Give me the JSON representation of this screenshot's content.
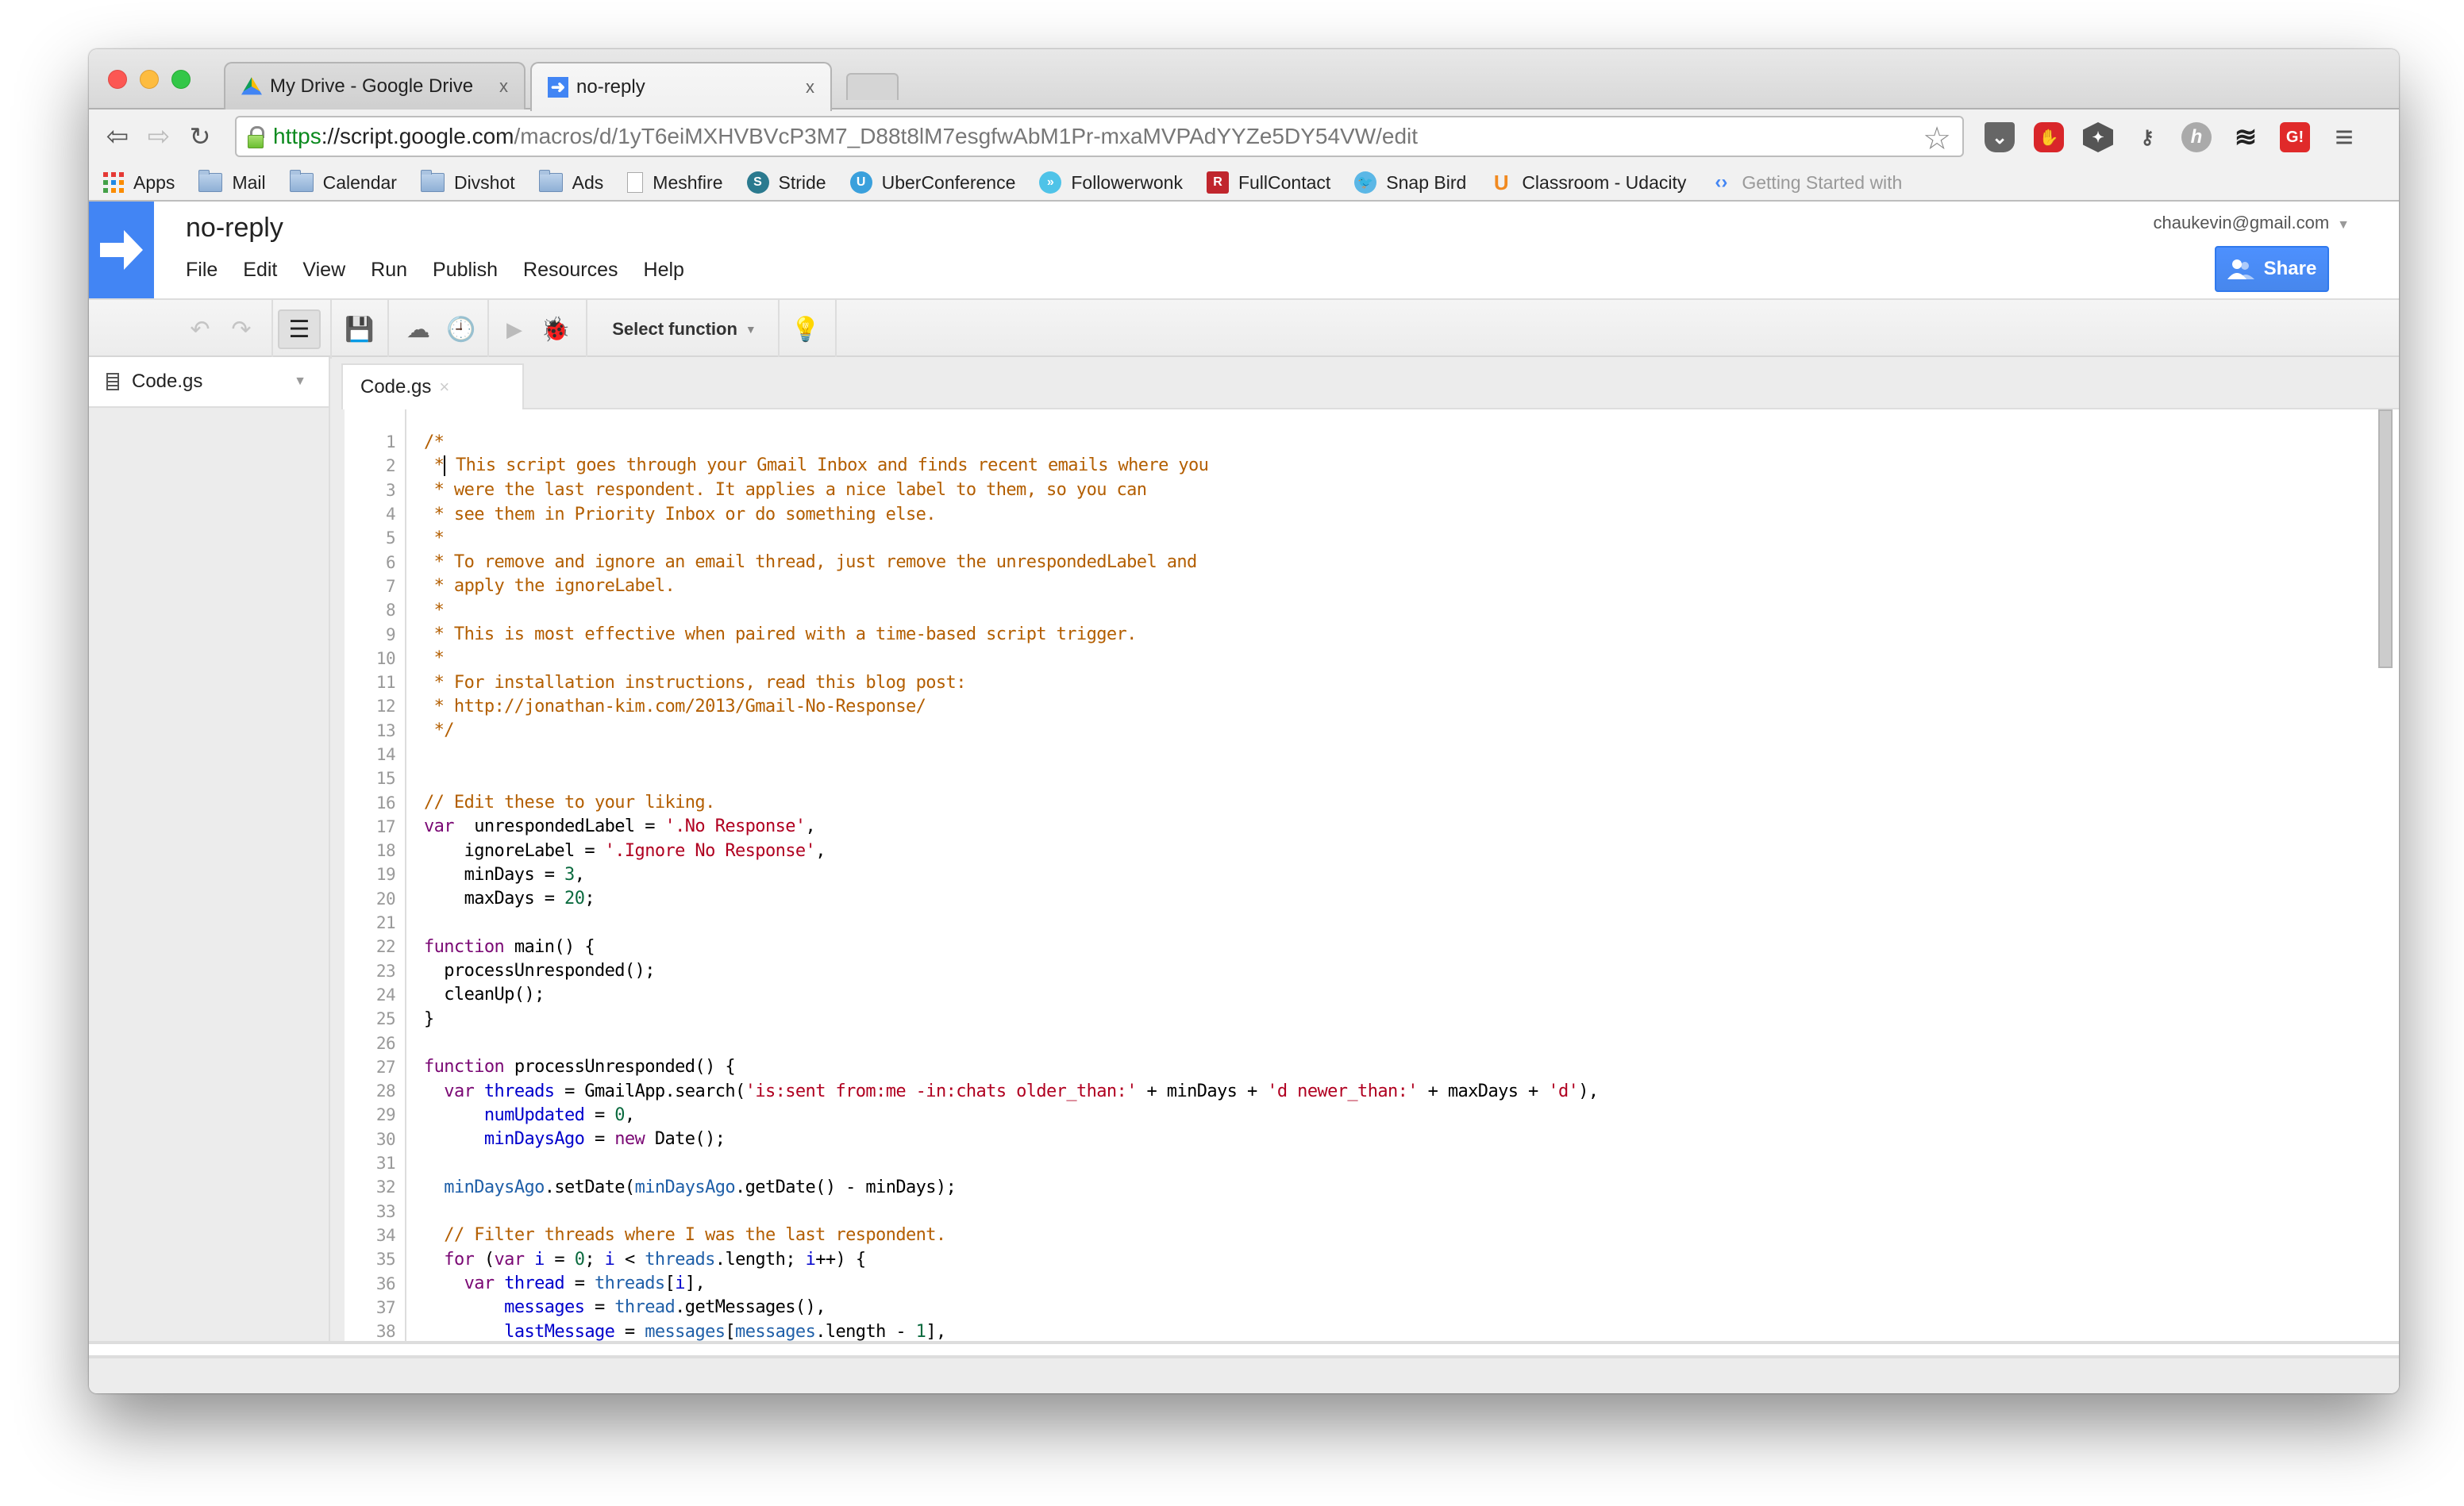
{
  "browser": {
    "tabs": [
      {
        "title": "My Drive - Google Drive",
        "icon": "google-drive-icon",
        "active": false,
        "close": "x"
      },
      {
        "title": "no-reply",
        "icon": "apps-script-icon",
        "active": true,
        "close": "x"
      }
    ],
    "url": {
      "scheme": "https",
      "host": "://script.google.com",
      "path": "/macros/d/1yT6eiMXHVBVcP3M7_D88t8lM7esgfwAbM1Pr-mxaMVPAdYYZe5DY54VW/edit"
    },
    "extensions": [
      {
        "name": "pocket-icon",
        "glyph": "⌄",
        "color": "#666666"
      },
      {
        "name": "adblock-icon",
        "glyph": "✋",
        "color": "#d9262a"
      },
      {
        "name": "hexagon-extension-icon",
        "glyph": "✦",
        "color": "#555555"
      },
      {
        "name": "key-icon",
        "glyph": "⚷",
        "color": "#555555"
      },
      {
        "name": "h-extension-icon",
        "glyph": "h",
        "color": "#aaaaaa"
      },
      {
        "name": "buffer-icon",
        "glyph": "≋",
        "color": "#222222"
      },
      {
        "name": "grammarly-g-icon",
        "glyph": "G!",
        "color": "#e02a2a"
      },
      {
        "name": "menu-icon",
        "glyph": "≡",
        "color": "#555555"
      }
    ],
    "bookmarks": [
      {
        "label": "Apps",
        "icon": "apps-grid-icon"
      },
      {
        "label": "Mail",
        "icon": "folder-icon"
      },
      {
        "label": "Calendar",
        "icon": "folder-icon"
      },
      {
        "label": "Divshot",
        "icon": "folder-icon"
      },
      {
        "label": "Ads",
        "icon": "folder-icon"
      },
      {
        "label": "Meshfire",
        "icon": "page-icon"
      },
      {
        "label": "Stride",
        "icon": "stride-icon"
      },
      {
        "label": "UberConference",
        "icon": "uberconference-icon"
      },
      {
        "label": "Followerwonk",
        "icon": "followerwonk-icon"
      },
      {
        "label": "FullContact",
        "icon": "fullcontact-icon"
      },
      {
        "label": "Snap Bird",
        "icon": "snapbird-icon"
      },
      {
        "label": "Classroom - Udacity",
        "icon": "udacity-icon"
      },
      {
        "label": "Getting Started with",
        "icon": "google-developers-icon"
      }
    ]
  },
  "app": {
    "project_title": "no-reply",
    "menu": [
      "File",
      "Edit",
      "View",
      "Run",
      "Publish",
      "Resources",
      "Help"
    ],
    "account": "chaukevin@gmail.com",
    "share_label": "Share",
    "accent": "#4285f4",
    "toolbar": {
      "select_function": "Select function"
    },
    "files": [
      {
        "name": "Code.gs"
      }
    ],
    "open_tab": "Code.gs"
  },
  "editor": {
    "lines": [
      [
        [
          "c-cm",
          "/*"
        ]
      ],
      [
        [
          "c-cm",
          " *"
        ],
        [
          "cursor",
          ""
        ],
        [
          "c-cm",
          " This script goes through your Gmail Inbox and finds recent emails where you"
        ]
      ],
      [
        [
          "c-cm",
          " * were the last respondent. It applies a nice label to them, so you can"
        ]
      ],
      [
        [
          "c-cm",
          " * see them in Priority Inbox or do something else."
        ]
      ],
      [
        [
          "c-cm",
          " *"
        ]
      ],
      [
        [
          "c-cm",
          " * To remove and ignore an email thread, just remove the unrespondedLabel and"
        ]
      ],
      [
        [
          "c-cm",
          " * apply the ignoreLabel."
        ]
      ],
      [
        [
          "c-cm",
          " *"
        ]
      ],
      [
        [
          "c-cm",
          " * This is most effective when paired with a time-based script trigger."
        ]
      ],
      [
        [
          "c-cm",
          " *"
        ]
      ],
      [
        [
          "c-cm",
          " * For installation instructions, read this blog post:"
        ]
      ],
      [
        [
          "c-cm",
          " * http://jonathan-kim.com/2013/Gmail-No-Response/"
        ]
      ],
      [
        [
          "c-cm",
          " */"
        ]
      ],
      [],
      [],
      [
        [
          "c-cm",
          "// Edit these to your liking."
        ]
      ],
      [
        [
          "c-kw",
          "var"
        ],
        [
          "",
          "  unrespondedLabel = "
        ],
        [
          "c-st",
          "'.No Response'"
        ],
        [
          "",
          ","
        ]
      ],
      [
        [
          "",
          "    ignoreLabel = "
        ],
        [
          "c-st",
          "'.Ignore No Response'"
        ],
        [
          "",
          ","
        ]
      ],
      [
        [
          "",
          "    minDays = "
        ],
        [
          "c-nu",
          "3"
        ],
        [
          "",
          ","
        ]
      ],
      [
        [
          "",
          "    maxDays = "
        ],
        [
          "c-nu",
          "20"
        ],
        [
          "",
          ";"
        ]
      ],
      [],
      [
        [
          "c-kw",
          "function"
        ],
        [
          "",
          " main() {"
        ]
      ],
      [
        [
          "",
          "  processUnresponded();"
        ]
      ],
      [
        [
          "",
          "  cleanUp();"
        ]
      ],
      [
        [
          "",
          "}"
        ]
      ],
      [],
      [
        [
          "c-kw",
          "function"
        ],
        [
          "",
          " processUnresponded() {"
        ]
      ],
      [
        [
          "",
          "  "
        ],
        [
          "c-kw",
          "var"
        ],
        [
          "",
          " "
        ],
        [
          "c-vr",
          "threads"
        ],
        [
          "",
          " = GmailApp.search("
        ],
        [
          "c-st",
          "'is:sent from:me -in:chats older_than:'"
        ],
        [
          "",
          " + minDays + "
        ],
        [
          "c-st",
          "'d newer_than:'"
        ],
        [
          "",
          " + maxDays + "
        ],
        [
          "c-st",
          "'d'"
        ],
        [
          "",
          "),"
        ]
      ],
      [
        [
          "",
          "      "
        ],
        [
          "c-vr",
          "numUpdated"
        ],
        [
          "",
          " = "
        ],
        [
          "c-nu",
          "0"
        ],
        [
          "",
          ","
        ]
      ],
      [
        [
          "",
          "      "
        ],
        [
          "c-vr",
          "minDaysAgo"
        ],
        [
          "",
          " = "
        ],
        [
          "c-kw",
          "new"
        ],
        [
          "",
          " Date();"
        ]
      ],
      [],
      [
        [
          "",
          "  "
        ],
        [
          "c-pr",
          "minDaysAgo"
        ],
        [
          "",
          ".setDate("
        ],
        [
          "c-pr",
          "minDaysAgo"
        ],
        [
          "",
          ".getDate() - minDays);"
        ]
      ],
      [],
      [
        [
          "",
          "  "
        ],
        [
          "c-cm",
          "// Filter threads where I was the last respondent."
        ]
      ],
      [
        [
          "",
          "  "
        ],
        [
          "c-kw",
          "for"
        ],
        [
          "",
          " ("
        ],
        [
          "c-kw",
          "var"
        ],
        [
          "",
          " "
        ],
        [
          "c-vr",
          "i"
        ],
        [
          "",
          " = "
        ],
        [
          "c-nu",
          "0"
        ],
        [
          "",
          "; "
        ],
        [
          "c-vr",
          "i"
        ],
        [
          "",
          " < "
        ],
        [
          "c-pr",
          "threads"
        ],
        [
          "",
          ".length; "
        ],
        [
          "c-vr",
          "i"
        ],
        [
          "",
          "++) {"
        ]
      ],
      [
        [
          "",
          "    "
        ],
        [
          "c-kw",
          "var"
        ],
        [
          "",
          " "
        ],
        [
          "c-vr",
          "thread"
        ],
        [
          "",
          " = "
        ],
        [
          "c-pr",
          "threads"
        ],
        [
          "",
          "["
        ],
        [
          "c-vr",
          "i"
        ],
        [
          "",
          "],"
        ]
      ],
      [
        [
          "",
          "        "
        ],
        [
          "c-vr",
          "messages"
        ],
        [
          "",
          " = "
        ],
        [
          "c-pr",
          "thread"
        ],
        [
          "",
          ".getMessages(),"
        ]
      ],
      [
        [
          "",
          "        "
        ],
        [
          "c-vr",
          "lastMessage"
        ],
        [
          "",
          " = "
        ],
        [
          "c-pr",
          "messages"
        ],
        [
          "",
          "["
        ],
        [
          "c-pr",
          "messages"
        ],
        [
          "",
          ".length - "
        ],
        [
          "c-nu",
          "1"
        ],
        [
          "",
          "],"
        ]
      ]
    ]
  }
}
